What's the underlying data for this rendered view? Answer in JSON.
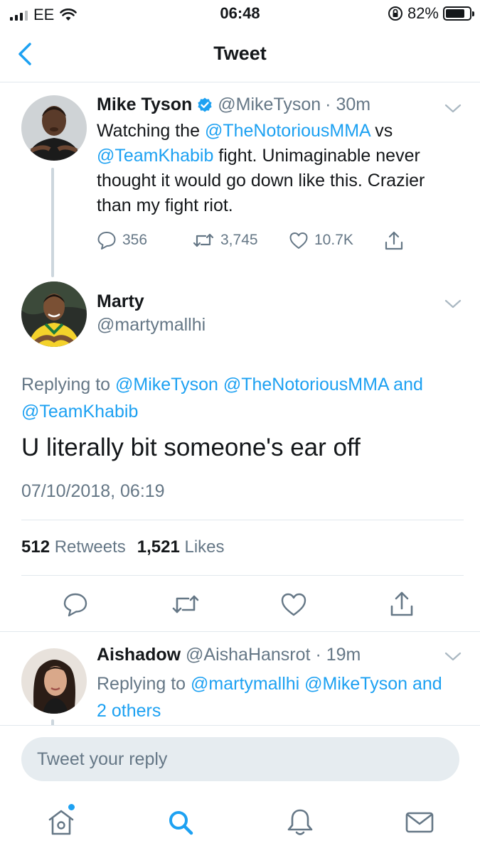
{
  "status_bar": {
    "carrier": "EE",
    "time": "06:48",
    "battery_percent": "82%",
    "battery_level": 0.82
  },
  "nav": {
    "title": "Tweet",
    "back_icon": "chevron-left-icon"
  },
  "parent_tweet": {
    "name": "Mike Tyson",
    "handle": "@MikeTyson",
    "time": "· 30m",
    "verified": true,
    "text_parts": {
      "p1": "Watching the ",
      "mention1": "@TheNotoriousMMA",
      "p2": " vs ",
      "mention2": "@TeamKhabib",
      "p3": " fight. Unimaginable never thought it would go down like this. Crazier than my fight riot."
    },
    "replies": "356",
    "retweets": "3,745",
    "likes": "10.7K"
  },
  "main_tweet": {
    "name": "Marty",
    "handle": "@martymallhi",
    "replying_label": "Replying to ",
    "replying_mentions": "@MikeTyson @TheNotoriousMMA and @TeamKhabib",
    "text": "U literally bit someone's ear off",
    "datetime": "07/10/2018, 06:19",
    "retweet_count": "512",
    "retweet_label": "Retweets",
    "like_count": "1,521",
    "like_label": "Likes"
  },
  "reply_tweet": {
    "name": "Aishadow",
    "handle": "@AishaHansrot",
    "time": "· 19m",
    "replying_label": "Replying to ",
    "replying_mentions": "@martymallhi @MikeTyson and 2 others"
  },
  "reply_box": {
    "placeholder": "Tweet your reply"
  },
  "tab_bar": {
    "tabs": [
      "home-icon",
      "search-icon",
      "bell-icon",
      "mail-icon"
    ],
    "home_has_notification": true
  },
  "colors": {
    "accent": "#1da1f2",
    "text": "#14171a",
    "secondary": "#657786",
    "border": "#e1e8ed"
  }
}
